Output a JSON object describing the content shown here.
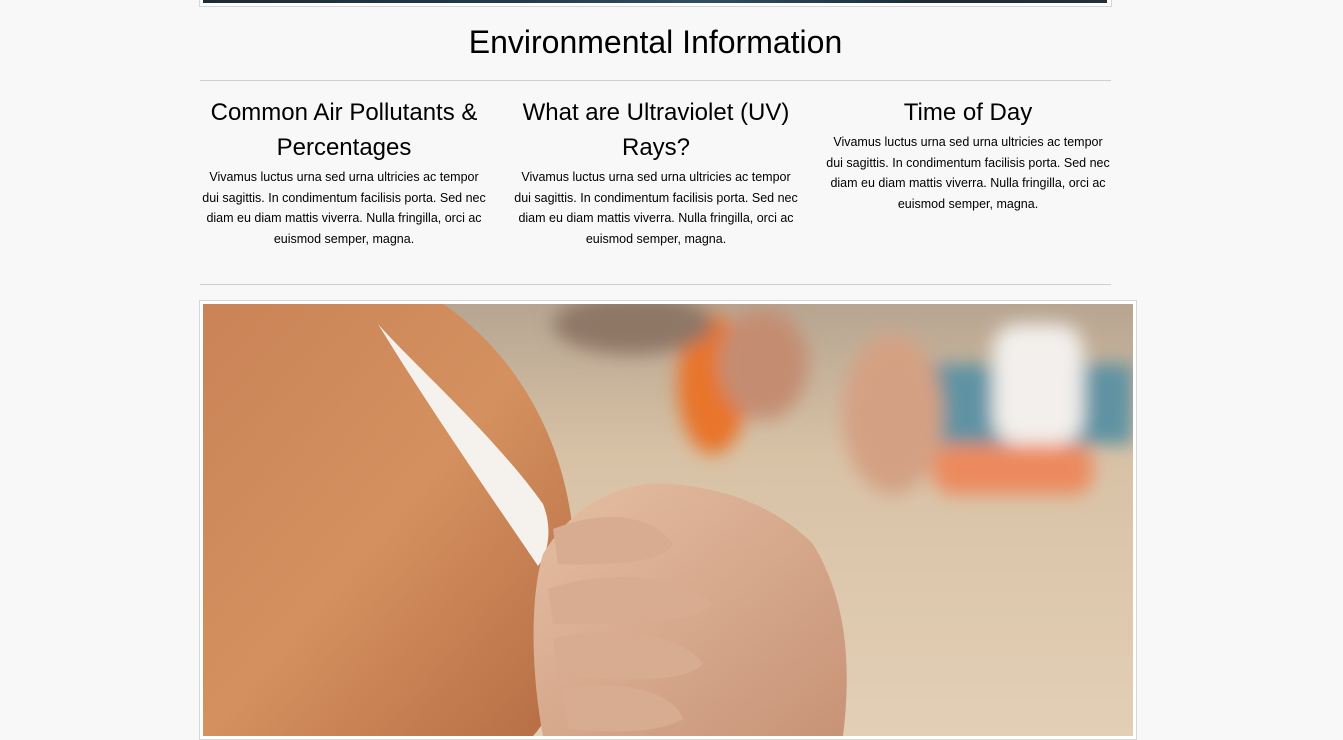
{
  "page": {
    "title": "Environmental Information"
  },
  "columns": [
    {
      "heading": "Common Air Pollutants & Percentages",
      "body": "Vivamus luctus urna sed urna ultricies ac tempor dui sagittis. In condimentum facilisis porta. Sed nec diam eu diam mattis viverra. Nulla fringilla, orci ac euismod semper, magna."
    },
    {
      "heading": "What are Ultraviolet (UV) Rays?",
      "body": "Vivamus luctus urna sed urna ultricies ac tempor dui sagittis. In condimentum facilisis porta. Sed nec diam eu diam mattis viverra. Nulla fringilla, orci ac euismod semper, magna."
    },
    {
      "heading": "Time of Day",
      "body": "Vivamus luctus urna sed urna ultricies ac tempor dui sagittis. In condimentum facilisis porta. Sed nec diam eu diam mattis viverra. Nulla fringilla, orci ac euismod semper, magna."
    }
  ],
  "colors": {
    "background": "#f8f8f8",
    "rule": "#cfcfcf",
    "text": "#000000"
  }
}
